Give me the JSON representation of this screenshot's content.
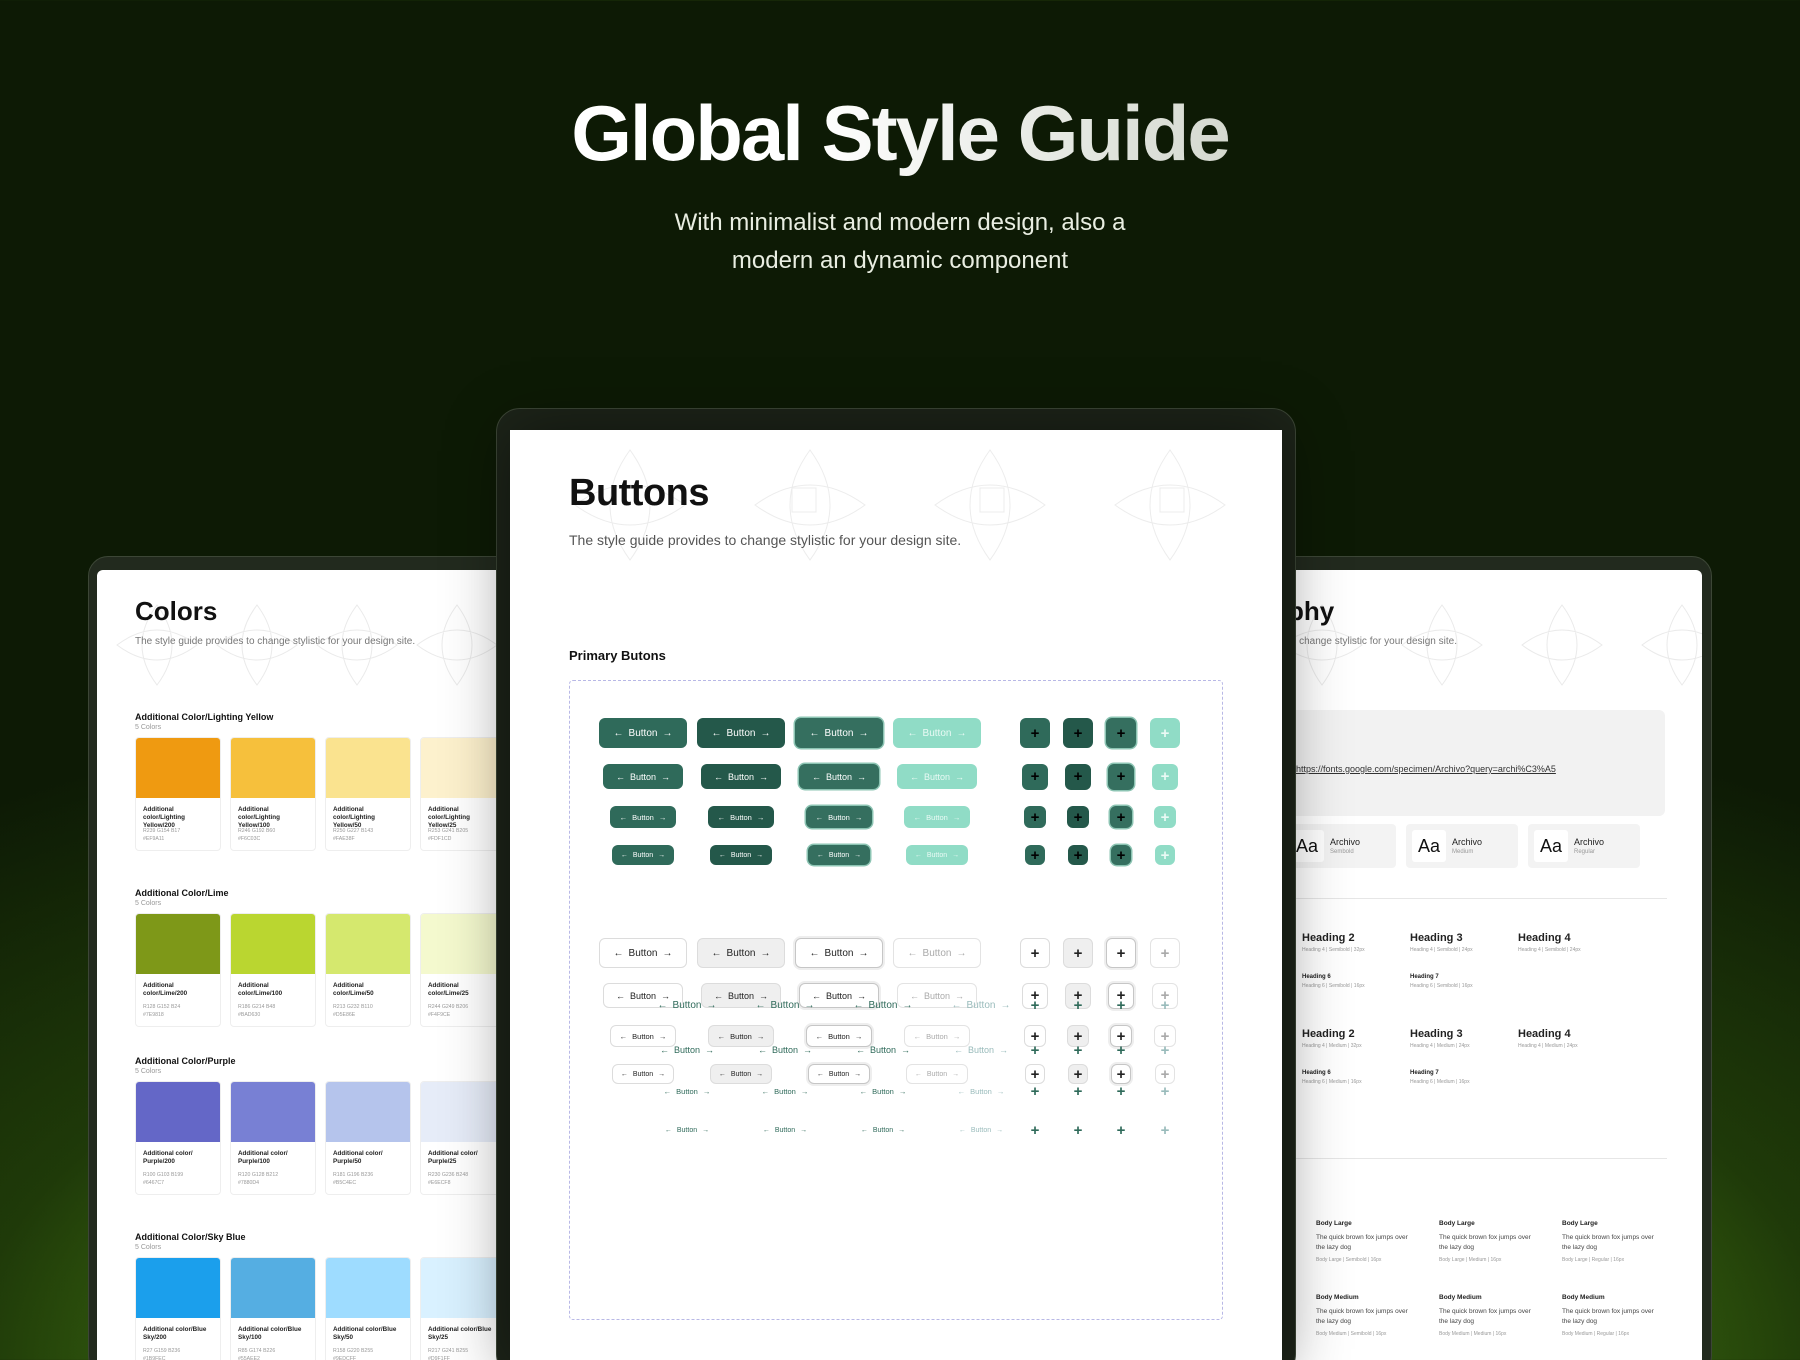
{
  "hero": {
    "title": "Global Style Guide",
    "subtitle": "With minimalist and modern design, also a modern an dynamic component"
  },
  "colors_card": {
    "title": "Colors",
    "subtitle": "The style guide provides to change stylistic for your design site.",
    "groups": [
      {
        "name": "Additional Color/Lighting Yellow",
        "count": "5 Colors",
        "swatches": [
          {
            "name": "Additional color/Lighting Yellow/200",
            "rgb": "R239 G154 B17",
            "hex": "#EF9A11",
            "color": "#ef9a11"
          },
          {
            "name": "Additional color/Lighting Yellow/100",
            "rgb": "R246 G192 B60",
            "hex": "#F6C03C",
            "color": "#f6c03c"
          },
          {
            "name": "Additional color/Lighting Yellow/50",
            "rgb": "R250 G227 B143",
            "hex": "#FAE38F",
            "color": "#fae38f"
          },
          {
            "name": "Additional color/Lighting Yellow/25",
            "rgb": "R253 G241 B205",
            "hex": "#FDF1CD",
            "color": "#fdf1cd"
          }
        ]
      },
      {
        "name": "Additional Color/Lime",
        "count": "5 Colors",
        "swatches": [
          {
            "name": "Additional color/Lime/200",
            "rgb": "R128 G152 B24",
            "hex": "#7E9818",
            "color": "#7e9818"
          },
          {
            "name": "Additional color/Lime/100",
            "rgb": "R186 G214 B48",
            "hex": "#BAD630",
            "color": "#bad630"
          },
          {
            "name": "Additional color/Lime/50",
            "rgb": "R213 G232 B110",
            "hex": "#D5E86E",
            "color": "#d5e86e"
          },
          {
            "name": "Additional color/Lime/25",
            "rgb": "R244 G249 B206",
            "hex": "#F4F9CE",
            "color": "#f4f9ce"
          }
        ]
      },
      {
        "name": "Additional Color/Purple",
        "count": "5 Colors",
        "swatches": [
          {
            "name": "Additional color/ Purple/200",
            "rgb": "R100 G103 B199",
            "hex": "#6467C7",
            "color": "#6467c7"
          },
          {
            "name": "Additional color/ Purple/100",
            "rgb": "R120 G128 B212",
            "hex": "#7880D4",
            "color": "#7880d4"
          },
          {
            "name": "Additional color/ Purple/50",
            "rgb": "R181 G196 B236",
            "hex": "#B5C4EC",
            "color": "#b5c4ec"
          },
          {
            "name": "Additional color/ Purple/25",
            "rgb": "R230 G236 B248",
            "hex": "#E6ECF8",
            "color": "#e6ecf8"
          }
        ]
      },
      {
        "name": "Additional Color/Sky Blue",
        "count": "5 Colors",
        "swatches": [
          {
            "name": "Additional color/Blue Sky/200",
            "rgb": "R27 G159 B236",
            "hex": "#1B9FEC",
            "color": "#1b9fec"
          },
          {
            "name": "Additional color/Blue Sky/100",
            "rgb": "R85 G174 B226",
            "hex": "#55AEE2",
            "color": "#55aee2"
          },
          {
            "name": "Additional color/Blue Sky/50",
            "rgb": "R158 G220 B255",
            "hex": "#9EDCFF",
            "color": "#9edcff"
          },
          {
            "name": "Additional color/Blue Sky/25",
            "rgb": "R217 G241 B255",
            "hex": "#D9F1FF",
            "color": "#d9f1ff"
          }
        ]
      }
    ]
  },
  "buttons_card": {
    "title": "Buttons",
    "subtitle": "The style guide provides to change stylistic for your design site.",
    "section": "Primary Butons",
    "button_label": "Button",
    "arrow_left": "←",
    "arrow_right": "→",
    "plus": "+",
    "accent_dark": "#2f6a5a",
    "accent_light": "#90dcc6"
  },
  "typography_card": {
    "title": "phy",
    "subtitle": "to change stylistic for your design site.",
    "url": "https://fonts.google.com/specimen/Archivo?query=archi%C3%A5",
    "fonts": [
      {
        "sample": "Aa",
        "name": "Archivo",
        "weight": "Sembold"
      },
      {
        "sample": "Aa",
        "name": "Archivo",
        "weight": "Medium"
      },
      {
        "sample": "Aa",
        "name": "Archivo",
        "weight": "Regular"
      }
    ],
    "headings_semibold": [
      {
        "label": "Heading 2",
        "meta": "Heading 4 | Semibold | 32px"
      },
      {
        "label": "Heading 3",
        "meta": "Heading 4 | Semibold | 24px"
      },
      {
        "label": "Heading 4",
        "meta": "Heading 4 | Semibold | 24px"
      },
      {
        "label": "Heading 6",
        "meta": "Heading 6 | Semibold | 16px"
      },
      {
        "label": "Heading 7",
        "meta": "Heading 6 | Semibold | 16px"
      }
    ],
    "headings_medium": [
      {
        "label": "Heading 2",
        "meta": "Heading 4 | Medium | 32px"
      },
      {
        "label": "Heading 3",
        "meta": "Heading 4 | Medium | 24px"
      },
      {
        "label": "Heading 4",
        "meta": "Heading 4 | Medium | 24px"
      },
      {
        "label": "Heading 6",
        "meta": "Heading 6 | Medium | 16px"
      },
      {
        "label": "Heading 7",
        "meta": "Heading 6 | Medium | 16px"
      }
    ],
    "body": [
      {
        "label": "Body Large",
        "text": "The quick brown fox jumps over the lazy dog",
        "meta": "Body Large | Semibold | 16px"
      },
      {
        "label": "Body Large",
        "text": "The quick brown fox jumps over the lazy dog",
        "meta": "Body Large | Medium | 16px"
      },
      {
        "label": "Body Large",
        "text": "The quick brown fox jumps over the lazy dog",
        "meta": "Body Large | Regular | 16px"
      },
      {
        "label": "Body Medium",
        "text": "The quick brown fox jumps over the lazy dog",
        "meta": "Body Medium | Semibold | 16px"
      },
      {
        "label": "Body Medium",
        "text": "The quick brown fox jumps over the lazy dog",
        "meta": "Body Medium | Medium | 16px"
      },
      {
        "label": "Body Medium",
        "text": "The quick brown fox jumps over the lazy dog",
        "meta": "Body Medium | Regular | 16px"
      }
    ]
  }
}
